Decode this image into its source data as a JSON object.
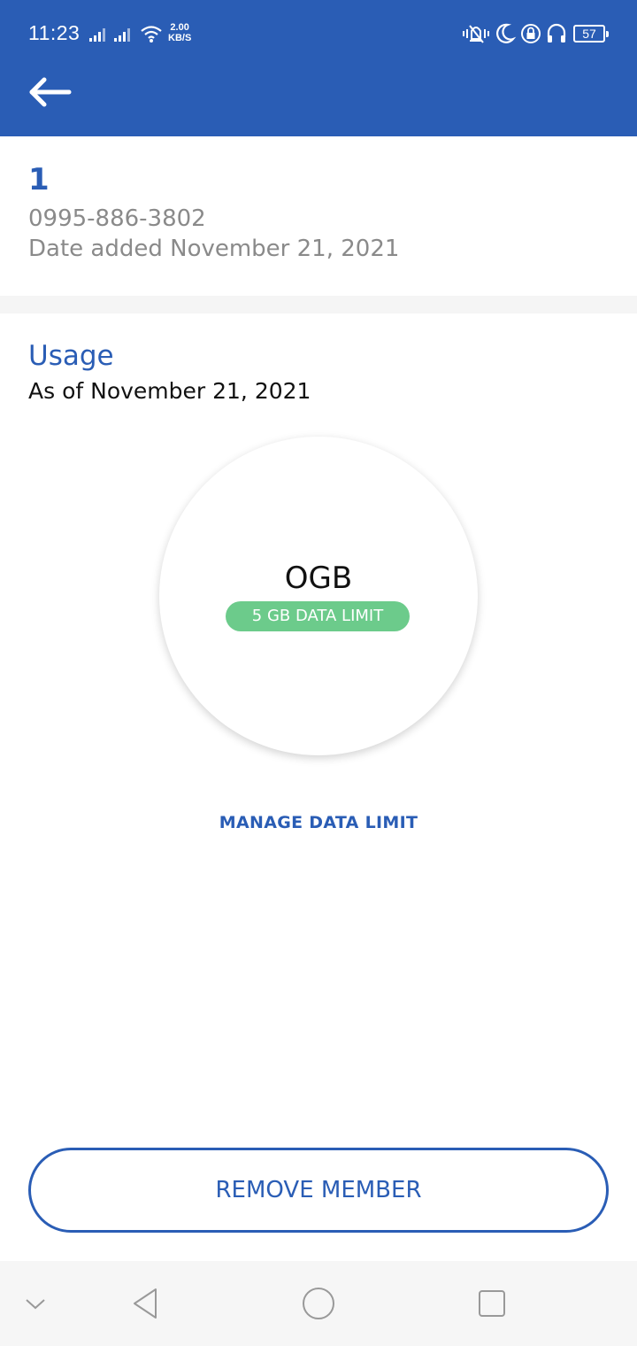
{
  "status_bar": {
    "time": "11:23",
    "speed_value": "2.00",
    "speed_unit": "KB/S",
    "battery": "57"
  },
  "member": {
    "name": "1",
    "number": "0995-886-3802",
    "date_added": "Date added November 21, 2021"
  },
  "usage": {
    "title": "Usage",
    "as_of": "As of November 21, 2021",
    "used": "OGB",
    "limit_label": "5 GB DATA LIMIT",
    "manage_label": "MANAGE DATA LIMIT"
  },
  "actions": {
    "remove_label": "REMOVE MEMBER"
  },
  "colors": {
    "primary": "#2a5db5",
    "pill": "#6ccb8b"
  },
  "icons": [
    "back-arrow-icon",
    "signal-icon",
    "wifi-icon",
    "vibrate-icon",
    "moon-icon",
    "lock-rotation-icon",
    "headphones-icon",
    "battery-icon",
    "nav-chevron-down-icon",
    "nav-back-icon",
    "nav-home-icon",
    "nav-recents-icon"
  ]
}
